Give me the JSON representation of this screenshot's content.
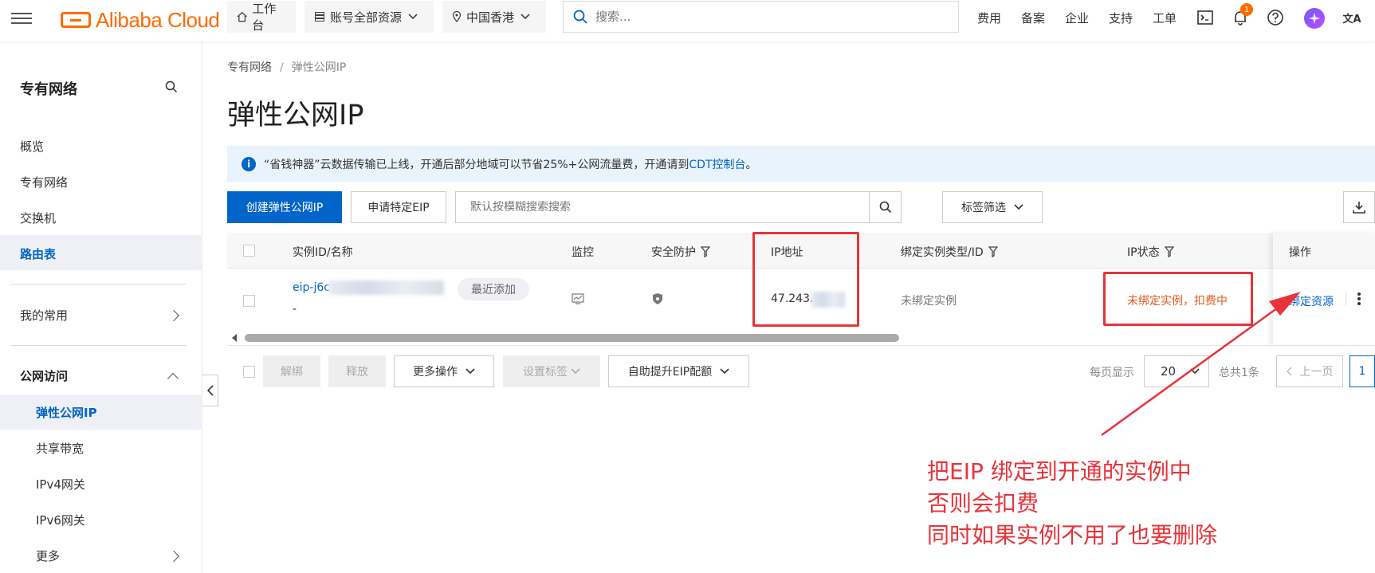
{
  "topbar": {
    "logo_text": "Alibaba Cloud",
    "workbench": "工作台",
    "resources": "账号全部资源",
    "region": "中国香港",
    "search_placeholder": "搜索...",
    "links": [
      "费用",
      "备案",
      "企业",
      "支持",
      "工单"
    ],
    "notification_count": "1",
    "lang_icon_text": "文A"
  },
  "sidebar": {
    "title": "专有网络",
    "items": [
      "概览",
      "专有网络",
      "交换机",
      "路由表"
    ],
    "favorites": "我的常用",
    "public_access": "公网访问",
    "sub_items": [
      "弹性公网IP",
      "共享带宽",
      "IPv4网关",
      "IPv6网关",
      "更多"
    ]
  },
  "breadcrumb": {
    "parent": "专有网络",
    "sep": "/",
    "current": "弹性公网IP"
  },
  "page_title": "弹性公网IP",
  "notice": {
    "text": "“省钱神器”云数据传输已上线，开通后部分地域可以节省25%+公网流量费，开通请到",
    "link": "CDT控制台",
    "end": "。"
  },
  "toolbar": {
    "create_btn": "创建弹性公网IP",
    "apply_btn": "申请特定EIP",
    "search_placeholder": "默认按模糊搜索搜索",
    "tag_filter": "标签筛选"
  },
  "table": {
    "columns": [
      "实例ID/名称",
      "监控",
      "安全防护",
      "IP地址",
      "绑定实例类型/ID",
      "IP状态",
      "操作"
    ],
    "row": {
      "id": "eip-j6c",
      "name": "-",
      "tag": "最近添加",
      "ip": "47.243.",
      "bind_type": "未绑定实例",
      "status": "未绑定实例，扣费中",
      "action": "绑定资源"
    }
  },
  "footer": {
    "unbind": "解绑",
    "release": "释放",
    "more_ops": "更多操作",
    "set_tag": "设置标签",
    "quota": "自助提升EIP配额",
    "per_page_label": "每页显示",
    "per_page": "20",
    "total": "总共1条",
    "prev": "上一页",
    "page": "1"
  },
  "annotation": {
    "lines": [
      "把EIP 绑定到开通的实例中",
      "否则会扣费",
      "同时如果实例不用了也要删除"
    ],
    "color": "#e8333a"
  },
  "colors": {
    "brand": "#ff6a00",
    "primary": "#0064c8",
    "alert": "#e8333a",
    "status_warn": "#e05a1c"
  }
}
